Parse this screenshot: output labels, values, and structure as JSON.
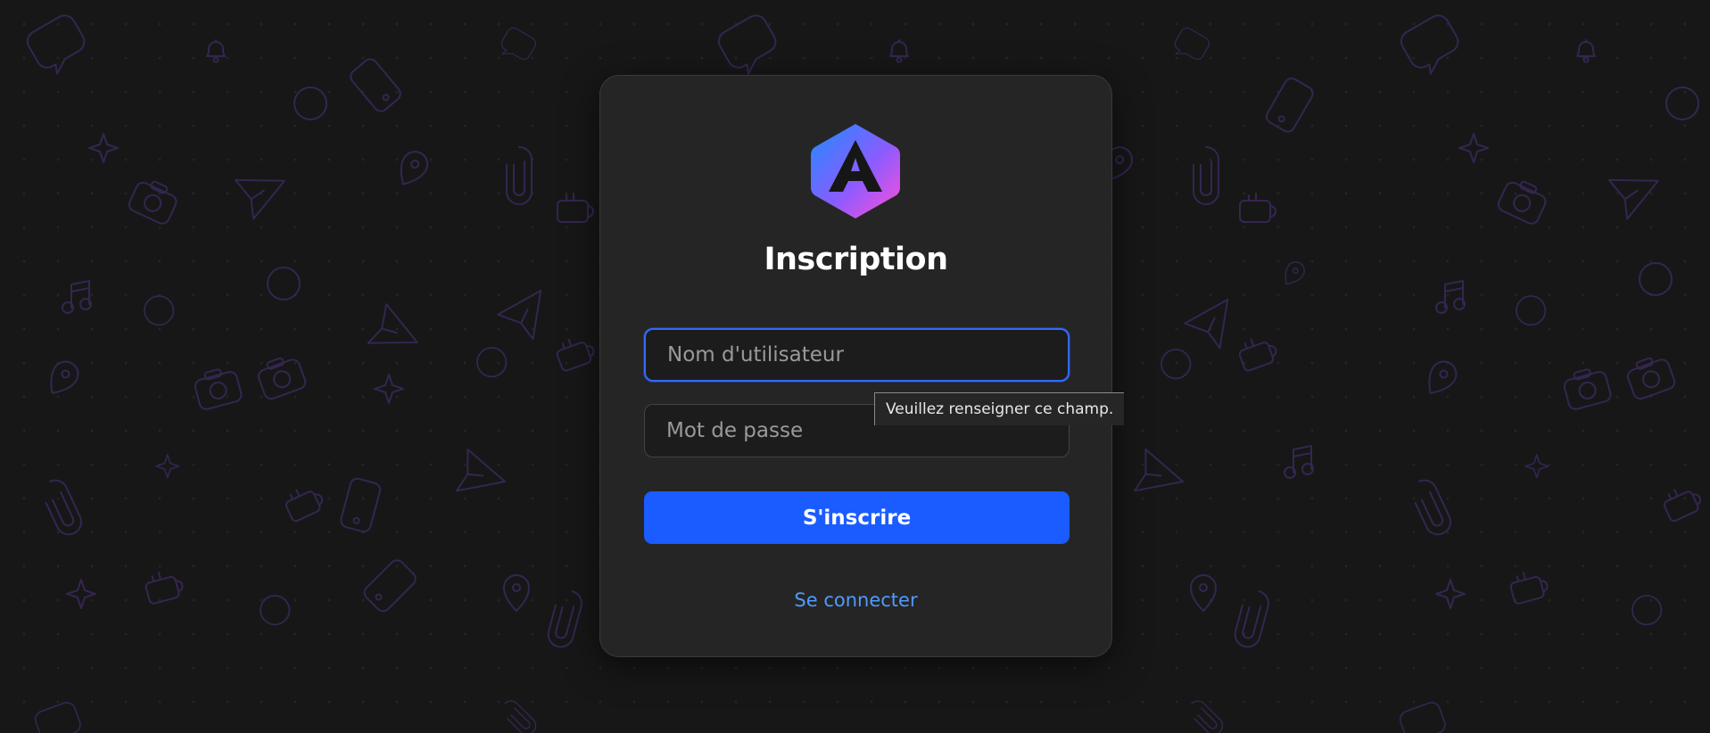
{
  "form": {
    "title": "Inscription",
    "username_placeholder": "Nom d'utilisateur",
    "username_value": "",
    "password_placeholder": "Mot de passe",
    "password_value": "",
    "submit_label": "S'inscrire",
    "login_link": "Se connecter",
    "validation_tooltip": "Veuillez renseigner ce champ."
  },
  "theme": {
    "accent": "#1a5cff",
    "link": "#4f9bff",
    "card_bg": "#262626",
    "page_bg": "#171717"
  },
  "icons": {
    "logo": "app-logo-icon",
    "background_pattern": "doodle-pattern"
  }
}
